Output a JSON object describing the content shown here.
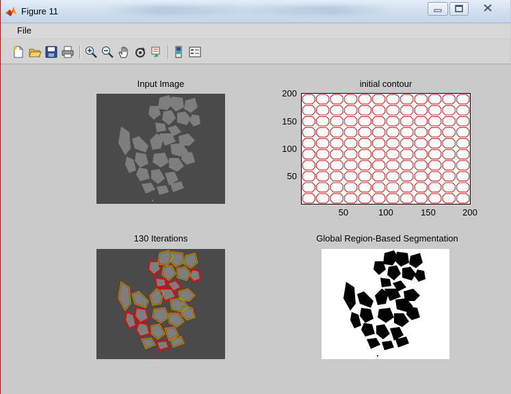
{
  "window": {
    "title": "Figure 11"
  },
  "menu": {
    "file": "File"
  },
  "toolbar": {
    "buttons": [
      "new-figure-icon",
      "open-file-icon",
      "save-icon",
      "print-icon",
      "zoom-in-icon",
      "zoom-out-icon",
      "pan-icon",
      "rotate-3d-icon",
      "data-cursor-icon",
      "colorbar-icon",
      "legend-icon"
    ]
  },
  "panels": {
    "input_title": "Input Image",
    "contour_title": "initial contour",
    "iter_title": "130 Iterations",
    "seg_title": "Global Region-Based Segmentation"
  },
  "colors": {
    "contour": "#cc2222",
    "background_gray": "#4a4a4a",
    "cell_gray": "#7e7e7e",
    "evolved_red": "#d01010",
    "evolved_green": "#66cc00"
  },
  "chart_data": {
    "type": "line",
    "title": "initial contour",
    "xlim": [
      1,
      200
    ],
    "ylim": [
      1,
      200
    ],
    "xticks": [
      "50",
      "100",
      "150",
      "200"
    ],
    "yticks": [
      "50",
      "100",
      "150",
      "200"
    ],
    "grid_cols": 12,
    "grid_rows": 10
  }
}
